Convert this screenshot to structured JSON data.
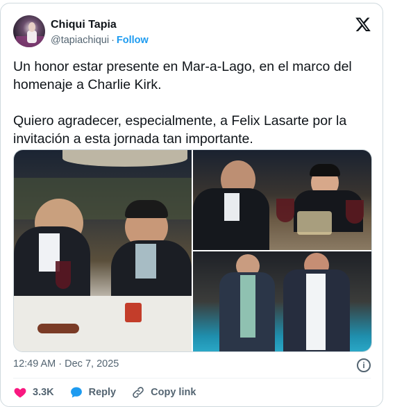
{
  "user": {
    "name": "Chiqui Tapia",
    "handle": "@tapiachiqui",
    "separator": "·",
    "follow_label": "Follow"
  },
  "tweet": {
    "paragraph1": "Un honor estar presente en Mar-a-Lago, en el marco del homenaje a Charlie Kirk.",
    "paragraph2": "Quiero agradecer, especialmente, a Felix Lasarte por la invitación a esta jornada tan importante."
  },
  "timestamp": "12:49 AM · Dec 7, 2025",
  "actions": {
    "likes": "3.3K",
    "reply_label": "Reply",
    "copy_link_label": "Copy link"
  },
  "icons": {
    "platform": "x-logo-icon",
    "info": "info-icon",
    "like": "heart-icon",
    "reply": "speech-bubble-icon",
    "link": "link-icon"
  },
  "colors": {
    "accent": "#1d9bf0",
    "like": "#f91880",
    "text": "#0f1419",
    "muted": "#536471"
  }
}
